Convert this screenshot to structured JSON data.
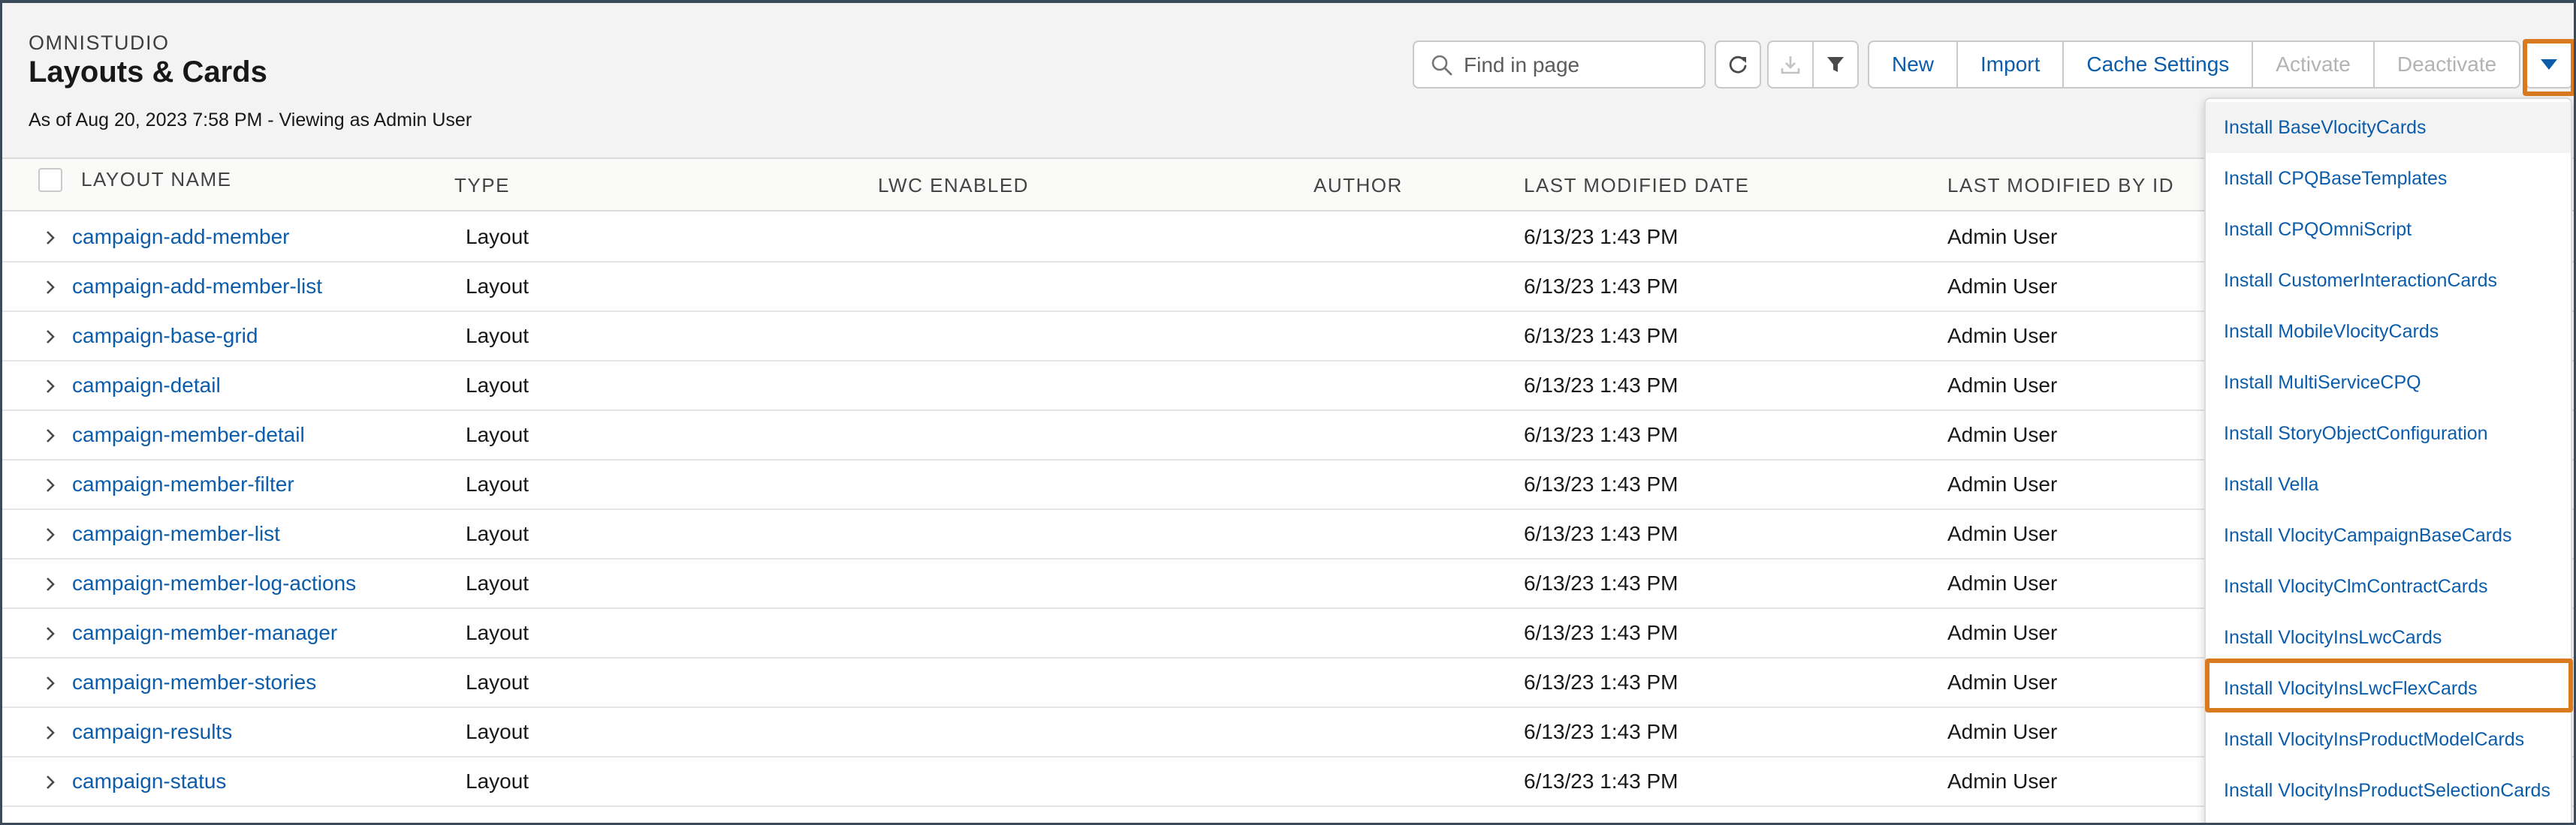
{
  "header": {
    "eyebrow": "OMNISTUDIO",
    "title": "Layouts & Cards",
    "meta": "As of Aug 20, 2023 7:58 PM - Viewing as Admin User"
  },
  "search": {
    "placeholder": "Find in page"
  },
  "toolbar": {
    "refresh_icon": "refresh-icon",
    "download_icon": "download-icon",
    "filter_icon": "filter-icon",
    "buttons": {
      "new": "New",
      "import": "Import",
      "cache_settings": "Cache Settings",
      "activate": "Activate",
      "deactivate": "Deactivate"
    },
    "menu_icon": "chevron-down-icon"
  },
  "table": {
    "columns": {
      "name": "LAYOUT NAME",
      "type": "TYPE",
      "lwc": "LWC ENABLED",
      "author": "AUTHOR",
      "modified_date": "LAST MODIFIED DATE",
      "modified_by": "LAST MODIFIED BY ID"
    },
    "rows": [
      {
        "name": "campaign-add-member",
        "type": "Layout",
        "date": "6/13/23 1:43 PM",
        "by": "Admin User"
      },
      {
        "name": "campaign-add-member-list",
        "type": "Layout",
        "date": "6/13/23 1:43 PM",
        "by": "Admin User"
      },
      {
        "name": "campaign-base-grid",
        "type": "Layout",
        "date": "6/13/23 1:43 PM",
        "by": "Admin User"
      },
      {
        "name": "campaign-detail",
        "type": "Layout",
        "date": "6/13/23 1:43 PM",
        "by": "Admin User"
      },
      {
        "name": "campaign-member-detail",
        "type": "Layout",
        "date": "6/13/23 1:43 PM",
        "by": "Admin User"
      },
      {
        "name": "campaign-member-filter",
        "type": "Layout",
        "date": "6/13/23 1:43 PM",
        "by": "Admin User"
      },
      {
        "name": "campaign-member-list",
        "type": "Layout",
        "date": "6/13/23 1:43 PM",
        "by": "Admin User"
      },
      {
        "name": "campaign-member-log-actions",
        "type": "Layout",
        "date": "6/13/23 1:43 PM",
        "by": "Admin User"
      },
      {
        "name": "campaign-member-manager",
        "type": "Layout",
        "date": "6/13/23 1:43 PM",
        "by": "Admin User"
      },
      {
        "name": "campaign-member-stories",
        "type": "Layout",
        "date": "6/13/23 1:43 PM",
        "by": "Admin User"
      },
      {
        "name": "campaign-results",
        "type": "Layout",
        "date": "6/13/23 1:43 PM",
        "by": "Admin User"
      },
      {
        "name": "campaign-status",
        "type": "Layout",
        "date": "6/13/23 1:43 PM",
        "by": "Admin User"
      }
    ]
  },
  "dropdown": {
    "items": [
      "Install BaseVlocityCards",
      "Install CPQBaseTemplates",
      "Install CPQOmniScript",
      "Install CustomerInteractionCards",
      "Install MobileVlocityCards",
      "Install MultiServiceCPQ",
      "Install StoryObjectConfiguration",
      "Install Vella",
      "Install VlocityCampaignBaseCards",
      "Install VlocityClmContractCards",
      "Install VlocityInsLwcCards",
      "Install VlocityInsLwcFlexCards",
      "Install VlocityInsProductModelCards",
      "Install VlocityInsProductSelectionCards"
    ],
    "highlighted_item": "Install VlocityInsLwcFlexCards"
  },
  "colors": {
    "link": "#0b5cab",
    "highlight": "#d97a1e",
    "header_bg": "#f3f3f3"
  }
}
